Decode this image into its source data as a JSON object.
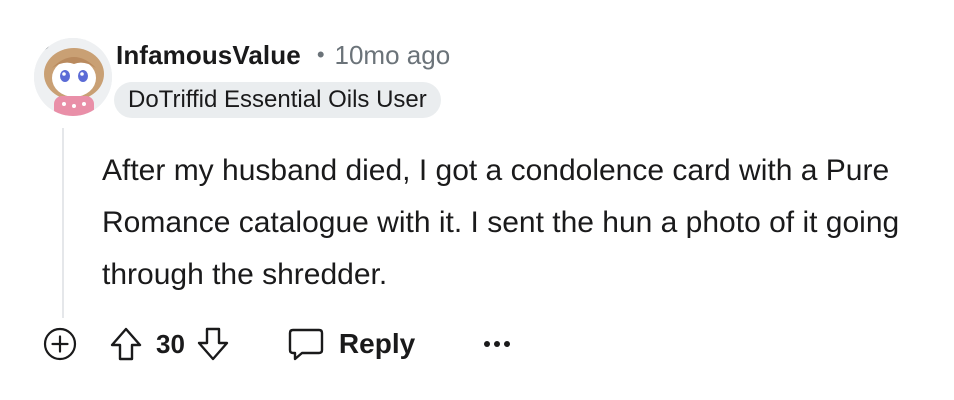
{
  "comment": {
    "author": "InfamousValue",
    "separator": "•",
    "timestamp": "10mo ago",
    "flair": "DoTriffid Essential Oils User",
    "body": "After my husband died, I got a condolence card with a Pure Romance catalogue with it. I sent the hun a photo of it going through the shredder.",
    "score": "30"
  },
  "actions": {
    "reply_label": "Reply"
  },
  "icons": {
    "expand": "plus-circle-icon",
    "upvote": "arrow-up-icon",
    "downvote": "arrow-down-icon",
    "reply": "speech-bubble-icon",
    "more": "ellipsis-icon"
  },
  "colors": {
    "text": "#1a1a1b",
    "meta": "#6b7379",
    "flair_bg": "#eaedef",
    "thread_line": "#e5e7ea"
  }
}
